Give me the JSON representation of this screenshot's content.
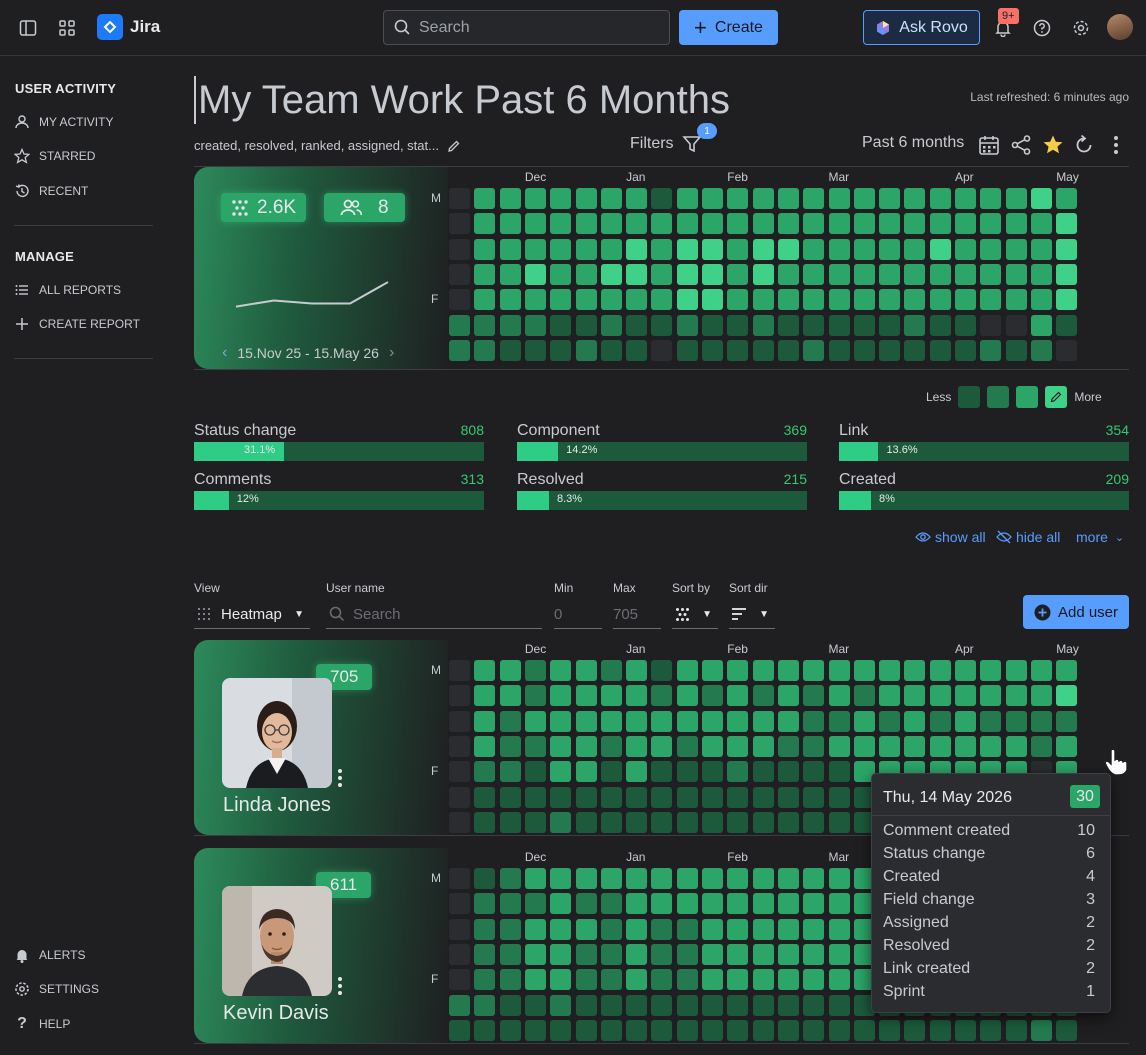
{
  "app": {
    "name": "Jira"
  },
  "topbar": {
    "search_placeholder": "Search",
    "create_label": "Create",
    "rovo_label": "Ask Rovo",
    "notifications_badge": "9+"
  },
  "sidebar": {
    "sections": [
      {
        "title": "USER ACTIVITY",
        "items": [
          {
            "label": "MY ACTIVITY",
            "icon": "person-icon"
          },
          {
            "label": "STARRED",
            "icon": "star-icon"
          },
          {
            "label": "RECENT",
            "icon": "history-icon"
          }
        ]
      },
      {
        "title": "MANAGE",
        "items": [
          {
            "label": "ALL REPORTS",
            "icon": "list-icon"
          },
          {
            "label": "CREATE REPORT",
            "icon": "plus-icon"
          }
        ]
      }
    ],
    "bottom": [
      {
        "label": "ALERTS",
        "icon": "bell-icon"
      },
      {
        "label": "SETTINGS",
        "icon": "gear-icon"
      },
      {
        "label": "HELP",
        "icon": "question-icon"
      }
    ]
  },
  "header": {
    "title": "My Team Work Past 6 Months",
    "last_refreshed": "Last refreshed: 6 minutes ago",
    "filter_summary": "created, resolved, ranked, assigned, stat...",
    "filters_label": "Filters",
    "filters_count": "1",
    "period_label": "Past 6 months"
  },
  "team_summary": {
    "events": "2.6K",
    "users": "8",
    "date_range": "15.Nov 25 - 15.May 26",
    "trend": [
      12,
      16,
      14,
      14,
      28
    ]
  },
  "heatmap_axis": {
    "months": [
      {
        "label": "Dec",
        "week": 3
      },
      {
        "label": "Jan",
        "week": 7
      },
      {
        "label": "Feb",
        "week": 11
      },
      {
        "label": "Mar",
        "week": 15
      },
      {
        "label": "Apr",
        "week": 20
      },
      {
        "label": "May",
        "week": 24
      }
    ],
    "day_labels": [
      {
        "label": "M",
        "row": 0
      },
      {
        "label": "F",
        "row": 4
      }
    ]
  },
  "heatmap_colors": [
    "#2b2c2f",
    "#1c5a3b",
    "#237a4e",
    "#2ba568",
    "#3fd188",
    "#7ddfa9"
  ],
  "heatmaps": {
    "team": [
      "0333333313333333333333343",
      "0333333333333333333333334",
      "0333333434434433333433334",
      "0334334434434333333333334",
      "0333333334433333333333334",
      "2222112112112111112110031",
      "2211121101111121111112120"
    ],
    "linda": [
      "0332332313333333333333333",
      "0332333323232323233333334",
      "0323333333333322323232222",
      "0322332332333223333333323",
      "0221331311121111333333303",
      "0111111111111111111111111",
      "0111211111111111111111111"
    ],
    "kevin": [
      "0123333333333333333333333",
      "0222322333333333333333333",
      "0223332322333333333333333",
      "0223322322333333333333333",
      "0223322322333333333333333",
      "2211211111111111111111111",
      "1111111111111111111111121"
    ]
  },
  "legend": {
    "less": "Less",
    "more": "More"
  },
  "categories": [
    {
      "label": "Status change",
      "value": "808",
      "pct": "31.1%",
      "fraction": 0.311
    },
    {
      "label": "Component",
      "value": "369",
      "pct": "14.2%",
      "fraction": 0.142
    },
    {
      "label": "Link",
      "value": "354",
      "pct": "13.6%",
      "fraction": 0.136
    },
    {
      "label": "Comments",
      "value": "313",
      "pct": "12%",
      "fraction": 0.12
    },
    {
      "label": "Resolved",
      "value": "215",
      "pct": "8.3%",
      "fraction": 0.083
    },
    {
      "label": "Created",
      "value": "209",
      "pct": "8%",
      "fraction": 0.08
    }
  ],
  "links": {
    "show_all": "show all",
    "hide_all": "hide all",
    "more": "more"
  },
  "controls": {
    "view_label": "View",
    "view_value": "Heatmap",
    "username_label": "User name",
    "username_placeholder": "Search",
    "min_label": "Min",
    "min_placeholder": "0",
    "max_label": "Max",
    "max_placeholder": "705",
    "sortby_label": "Sort by",
    "sortdir_label": "Sort dir",
    "add_user_label": "Add user"
  },
  "users": [
    {
      "name": "Linda Jones",
      "count": "705"
    },
    {
      "name": "Kevin Davis",
      "count": "611"
    }
  ],
  "tooltip": {
    "date": "Thu, 14 May 2026",
    "total": "30",
    "rows": [
      {
        "label": "Comment created",
        "value": "10"
      },
      {
        "label": "Status change",
        "value": "6"
      },
      {
        "label": "Created",
        "value": "4"
      },
      {
        "label": "Field change",
        "value": "3"
      },
      {
        "label": "Assigned",
        "value": "2"
      },
      {
        "label": "Resolved",
        "value": "2"
      },
      {
        "label": "Link created",
        "value": "2"
      },
      {
        "label": "Sprint",
        "value": "1"
      }
    ]
  }
}
